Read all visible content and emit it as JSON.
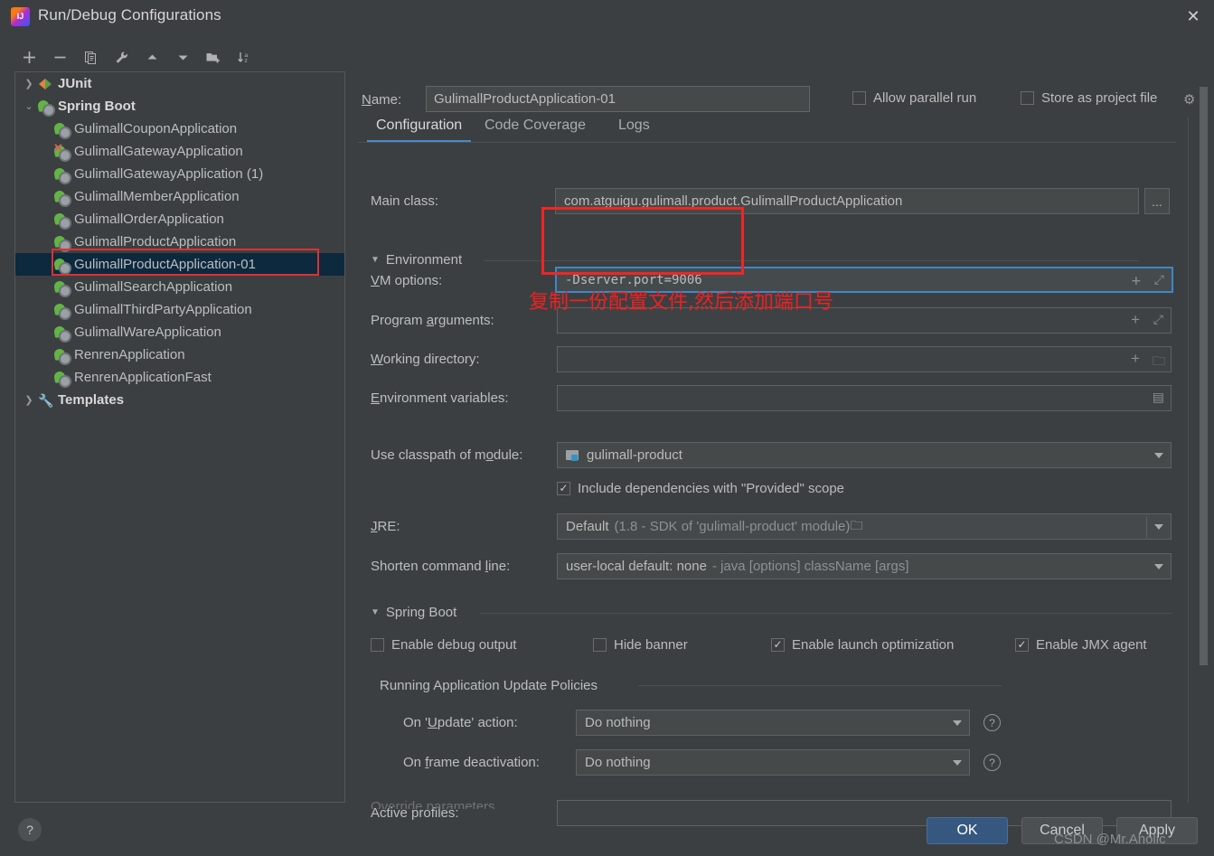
{
  "window": {
    "title": "Run/Debug Configurations",
    "app_icon": "intellij-idea-icon",
    "close_label": "✕"
  },
  "toolbar": {
    "items": [
      {
        "name": "add-configuration-button",
        "icon": "plus-icon",
        "label": "+"
      },
      {
        "name": "remove-configuration-button",
        "icon": "minus-icon",
        "label": "−"
      },
      {
        "name": "copy-configuration-button",
        "icon": "copy-icon",
        "label": "Copy"
      },
      {
        "name": "edit-templates-button",
        "icon": "wrench-icon",
        "label": "Edit Templates"
      },
      {
        "name": "move-up-button",
        "icon": "arrow-up-icon",
        "label": "Move Up"
      },
      {
        "name": "move-down-button",
        "icon": "arrow-down-icon",
        "label": "Move Down"
      },
      {
        "name": "new-folder-button",
        "icon": "folder-add-icon",
        "label": "New Folder"
      },
      {
        "name": "sort-button",
        "icon": "sort-alphabetical-icon",
        "label": "Sort"
      }
    ]
  },
  "tree": {
    "groups": [
      {
        "label": "JUnit",
        "icon": "junit-icon",
        "expanded": false
      },
      {
        "label": "Spring Boot",
        "icon": "spring-boot-icon",
        "expanded": true
      },
      {
        "label": "Templates",
        "icon": "wrench-icon",
        "expanded": false
      }
    ],
    "items": [
      {
        "label": "GulimallCouponApplication",
        "icon": "spring-boot-icon",
        "selected": false,
        "error": false
      },
      {
        "label": "GulimallGatewayApplication",
        "icon": "spring-boot-icon",
        "selected": false,
        "error": true
      },
      {
        "label": "GulimallGatewayApplication (1)",
        "icon": "spring-boot-icon",
        "selected": false,
        "error": false
      },
      {
        "label": "GulimallMemberApplication",
        "icon": "spring-boot-icon",
        "selected": false,
        "error": false
      },
      {
        "label": "GulimallOrderApplication",
        "icon": "spring-boot-icon",
        "selected": false,
        "error": false
      },
      {
        "label": "GulimallProductApplication",
        "icon": "spring-boot-icon",
        "selected": false,
        "error": false
      },
      {
        "label": "GulimallProductApplication-01",
        "icon": "spring-boot-icon",
        "selected": true,
        "error": false
      },
      {
        "label": "GulimallSearchApplication",
        "icon": "spring-boot-icon",
        "selected": false,
        "error": false
      },
      {
        "label": "GulimallThirdPartyApplication",
        "icon": "spring-boot-icon",
        "selected": false,
        "error": false
      },
      {
        "label": "GulimallWareApplication",
        "icon": "spring-boot-icon",
        "selected": false,
        "error": false
      },
      {
        "label": "RenrenApplication",
        "icon": "spring-boot-icon",
        "selected": false,
        "error": false
      },
      {
        "label": "RenrenApplicationFast",
        "icon": "spring-boot-icon",
        "selected": false,
        "error": false
      }
    ]
  },
  "header": {
    "name_label": "Name:",
    "name_value": "GulimallProductApplication-01",
    "allow_parallel_run": {
      "label": "Allow parallel run",
      "checked": false
    },
    "store_as_project_file": {
      "label": "Store as project file",
      "checked": false
    },
    "gear_icon": "gear-icon"
  },
  "tabs": [
    {
      "label": "Configuration",
      "active": true
    },
    {
      "label": "Code Coverage",
      "active": false
    },
    {
      "label": "Logs",
      "active": false
    }
  ],
  "form": {
    "main_class": {
      "label": "Main class:",
      "value": "com.atguigu.gulimall.product.GulimallProductApplication",
      "browse": "..."
    },
    "environment_section": "Environment",
    "vm_options": {
      "label": "VM options:",
      "value": "-Dserver.port=9006",
      "placeholder": ""
    },
    "program_arguments": {
      "label": "Program arguments:",
      "value": "",
      "placeholder": ""
    },
    "working_directory": {
      "label": "Working directory:",
      "value": "",
      "placeholder": ""
    },
    "environment_variables": {
      "label": "Environment variables:",
      "value": "",
      "placeholder": ""
    },
    "use_classpath_of_module": {
      "label": "Use classpath of module:",
      "value": "gulimall-product",
      "icon": "module-icon"
    },
    "include_provided": {
      "label": "Include dependencies with \"Provided\" scope",
      "checked": true
    },
    "jre": {
      "label": "JRE:",
      "value": "Default",
      "hint": "(1.8 - SDK of 'gulimall-product' module)"
    },
    "shorten_command_line": {
      "label": "Shorten command line:",
      "value": "user-local default: none",
      "hint": "- java [options] className [args]"
    },
    "spring_boot_section": "Spring Boot",
    "spring_checks": [
      {
        "label": "Enable debug output",
        "checked": false,
        "underline_index": 7
      },
      {
        "label": "Hide banner",
        "checked": false,
        "underline_index": 0
      },
      {
        "label": "Enable launch optimization",
        "checked": true,
        "underline_index": 0
      },
      {
        "label": "Enable JMX agent",
        "checked": true,
        "underline_index": 0
      }
    ],
    "update_policies_section": "Running Application Update Policies",
    "on_update_action": {
      "label": "On 'Update' action:",
      "value": "Do nothing",
      "help": "?"
    },
    "on_frame_deactivation": {
      "label": "On frame deactivation:",
      "value": "Do nothing",
      "help": "?"
    },
    "active_profiles": {
      "label": "Active profiles:",
      "value": "",
      "placeholder": ""
    },
    "override_parameters": "Override parameters"
  },
  "annotations": {
    "chinese_note": "复制一份配置文件,然后添加端口号",
    "highlight_color": "#ef2626"
  },
  "footer": {
    "help_icon": "question-mark-icon",
    "ok_label": "OK",
    "cancel_label": "Cancel",
    "apply_label": "Apply",
    "watermark": "CSDN @Mr.Aholic"
  }
}
